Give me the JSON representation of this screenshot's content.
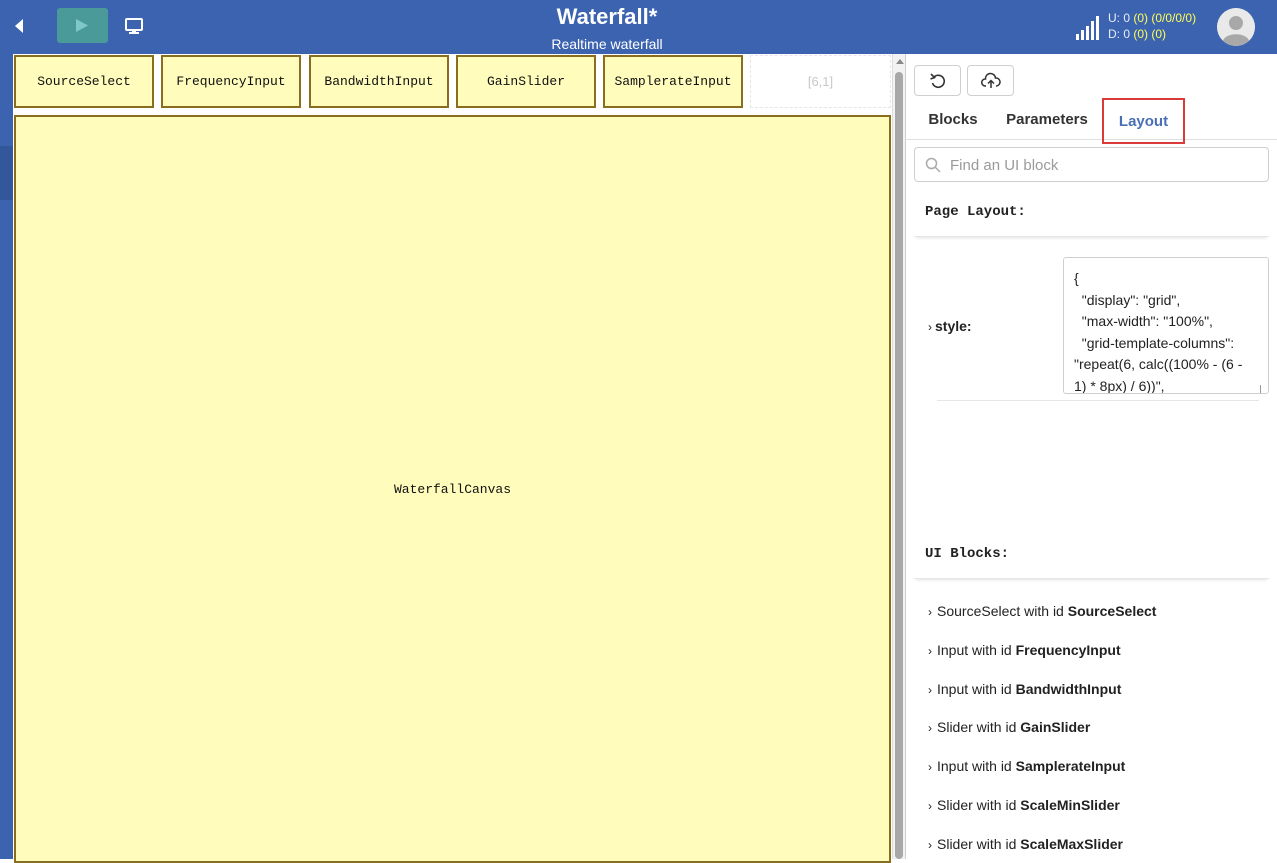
{
  "header": {
    "title": "Waterfall*",
    "subtitle": "Realtime waterfall",
    "stats_up_prefix": "U: 0",
    "stats_up_paren": "(0)",
    "stats_up_detail": "(0/0/0/0)",
    "stats_down_prefix": "D: 0",
    "stats_down_paren": "(0)",
    "stats_down_detail": "(0)",
    "back_icon": "chevron-left-icon",
    "play_icon": "play-icon",
    "monitor_icon": "monitor-icon",
    "signal_icon": "signal-bars-icon"
  },
  "canvas": {
    "blocks": [
      "SourceSelect",
      "FrequencyInput",
      "BandwidthInput",
      "GainSlider",
      "SamplerateInput"
    ],
    "empty_cell": "[6,1]",
    "main_block": "WaterfallCanvas"
  },
  "panel": {
    "tabs": [
      "Blocks",
      "Parameters",
      "Layout"
    ],
    "active_tab": "Layout",
    "search_placeholder": "Find an UI block",
    "page_layout_heading": "Page Layout:",
    "style_label": "style:",
    "style_code": "{\n  \"display\": \"grid\",\n  \"max-width\": \"100%\",\n  \"grid-template-columns\": \"repeat(6, calc((100% - (6 - 1) * 8px) / 6))\",",
    "ui_blocks_heading": "UI Blocks:",
    "ui_blocks": [
      {
        "prefix": "SourceSelect with id ",
        "id": "SourceSelect"
      },
      {
        "prefix": "Input with id ",
        "id": "FrequencyInput"
      },
      {
        "prefix": "Input with id ",
        "id": "BandwidthInput"
      },
      {
        "prefix": "Slider with id ",
        "id": "GainSlider"
      },
      {
        "prefix": "Input with id ",
        "id": "SamplerateInput"
      },
      {
        "prefix": "Slider with id ",
        "id": "ScaleMinSlider"
      },
      {
        "prefix": "Slider with id ",
        "id": "ScaleMaxSlider"
      }
    ]
  },
  "colors": {
    "header_bg": "#3b63b0",
    "block_fill": "#fffcbc",
    "block_border": "#8a6e1f",
    "active_tab_text": "#4a6fb5",
    "active_tab_outline": "#d93b3b",
    "stat_highlight": "#ffff55"
  }
}
